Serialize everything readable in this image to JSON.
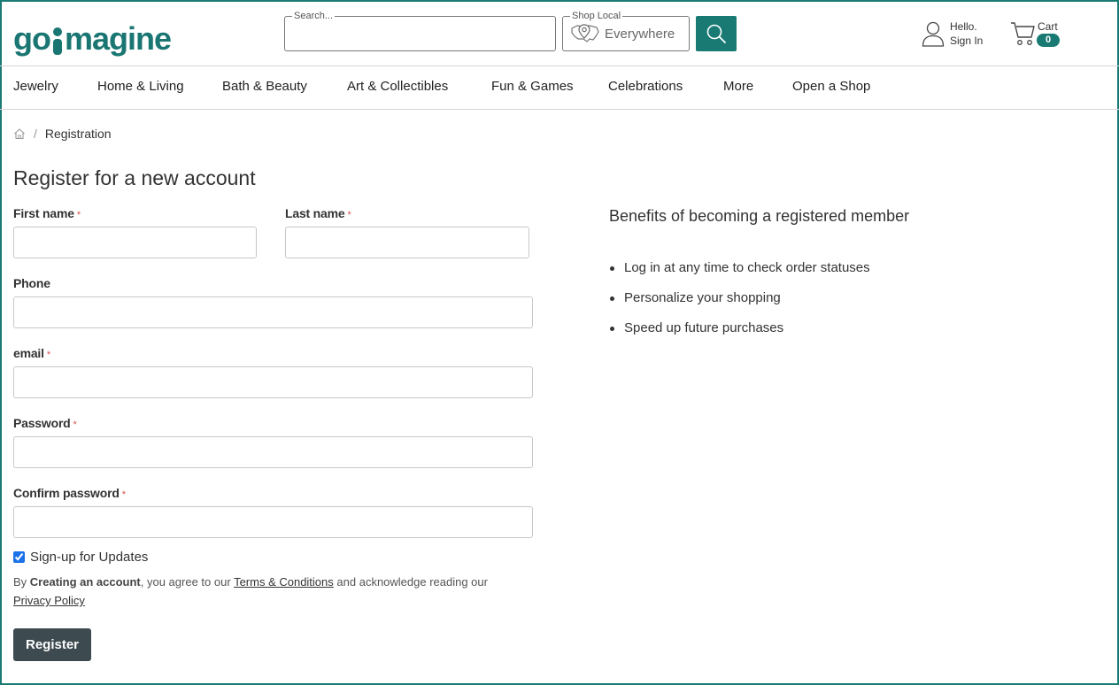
{
  "header": {
    "logo": {
      "prefix": "go",
      "suffix": "magine"
    },
    "search": {
      "legend": "Search...",
      "value": "",
      "placeholder": ""
    },
    "shop_local": {
      "legend": "Shop Local",
      "value": "Everywhere"
    },
    "account": {
      "greeting": "Hello.",
      "sign_in": "Sign In"
    },
    "cart": {
      "label": "Cart",
      "count": "0"
    }
  },
  "nav": {
    "items": [
      {
        "label": "Jewelry"
      },
      {
        "label": "Home & Living"
      },
      {
        "label": "Bath & Beauty"
      },
      {
        "label": "Art & Collectibles"
      },
      {
        "label": "Fun & Games"
      },
      {
        "label": "Celebrations"
      },
      {
        "label": "More"
      },
      {
        "label": "Open a Shop"
      }
    ]
  },
  "breadcrumb": {
    "separator": "/",
    "current": "Registration"
  },
  "form": {
    "title": "Register for a new account",
    "required_mark": "*",
    "first_name": {
      "label": "First name",
      "value": ""
    },
    "last_name": {
      "label": "Last name",
      "value": ""
    },
    "phone": {
      "label": "Phone",
      "value": ""
    },
    "email": {
      "label": "email",
      "value": ""
    },
    "password": {
      "label": "Password",
      "value": ""
    },
    "confirm_password": {
      "label": "Confirm password",
      "value": ""
    },
    "updates_checkbox": {
      "label": "Sign-up for Updates",
      "checked": true
    },
    "terms": {
      "by": "By",
      "creating": "Creating an account",
      "agree": ", you agree to our",
      "terms_link": "Terms & Conditions",
      "acknowledge": "and acknowledge reading our",
      "privacy_link": "Privacy Policy"
    },
    "submit_label": "Register"
  },
  "benefits": {
    "title": "Benefits of becoming a registered member",
    "items": [
      "Log in at any time to check order statuses",
      "Personalize your shopping",
      "Speed up future purchases"
    ]
  },
  "colors": {
    "brand": "#187a73",
    "button_dark": "#3d4a4f",
    "required": "#d9534f"
  }
}
